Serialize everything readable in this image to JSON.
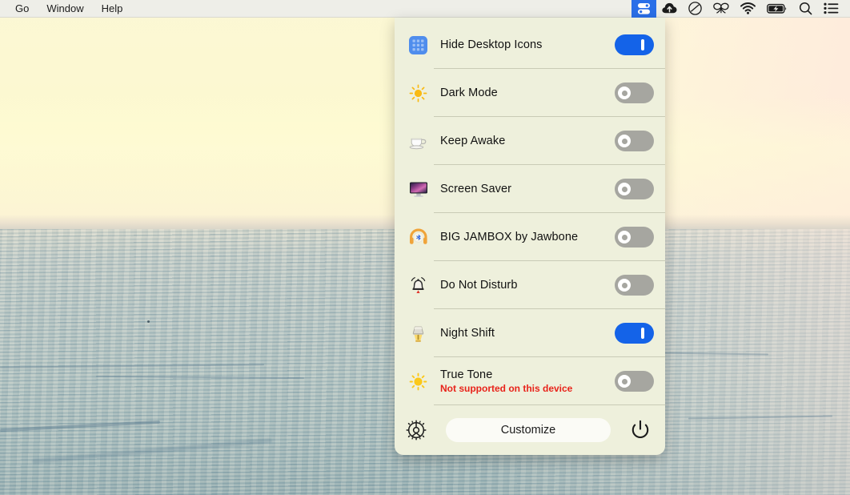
{
  "menubar": {
    "items": [
      {
        "label": "Go"
      },
      {
        "label": "Window"
      },
      {
        "label": "Help"
      }
    ],
    "status_icons": [
      {
        "name": "one-switch-icon",
        "active": true
      },
      {
        "name": "cloud-upload-icon",
        "active": false
      },
      {
        "name": "dropbox-circle-icon",
        "active": false
      },
      {
        "name": "butterfly-icon",
        "active": false
      },
      {
        "name": "wifi-icon",
        "active": false
      },
      {
        "name": "battery-charging-icon",
        "active": false
      },
      {
        "name": "spotlight-search-icon",
        "active": false
      },
      {
        "name": "control-center-icon",
        "active": false
      }
    ]
  },
  "panel": {
    "rows": [
      {
        "icon": "desktop-grid-icon",
        "label": "Hide Desktop Icons",
        "sub": "",
        "toggle": "on"
      },
      {
        "icon": "sun-icon",
        "label": "Dark Mode",
        "sub": "",
        "toggle": "off"
      },
      {
        "icon": "coffee-cup-icon",
        "label": "Keep Awake",
        "sub": "",
        "toggle": "off"
      },
      {
        "icon": "monitor-icon",
        "label": "Screen Saver",
        "sub": "",
        "toggle": "off"
      },
      {
        "icon": "headphones-bluetooth-icon",
        "label": "BIG JAMBOX by Jawbone",
        "sub": "",
        "toggle": "off"
      },
      {
        "icon": "bell-icon",
        "label": "Do Not Disturb",
        "sub": "",
        "toggle": "off"
      },
      {
        "icon": "lamp-icon",
        "label": "Night Shift",
        "sub": "",
        "toggle": "on"
      },
      {
        "icon": "sun-bright-icon",
        "label": "True Tone",
        "sub": "Not supported on this device",
        "toggle": "off"
      }
    ],
    "footer": {
      "settings_icon": "gear-icon",
      "customize_label": "Customize",
      "power_icon": "power-icon"
    }
  },
  "colors": {
    "panel_bg": "#eef0dc",
    "toggle_on": "#1463e8",
    "toggle_off": "#a6a6a0",
    "menubar_bg": "#eeeee8",
    "menubar_active": "#2a6fe8",
    "warning_text": "#e8231a",
    "divider": "#c9cbb6"
  }
}
